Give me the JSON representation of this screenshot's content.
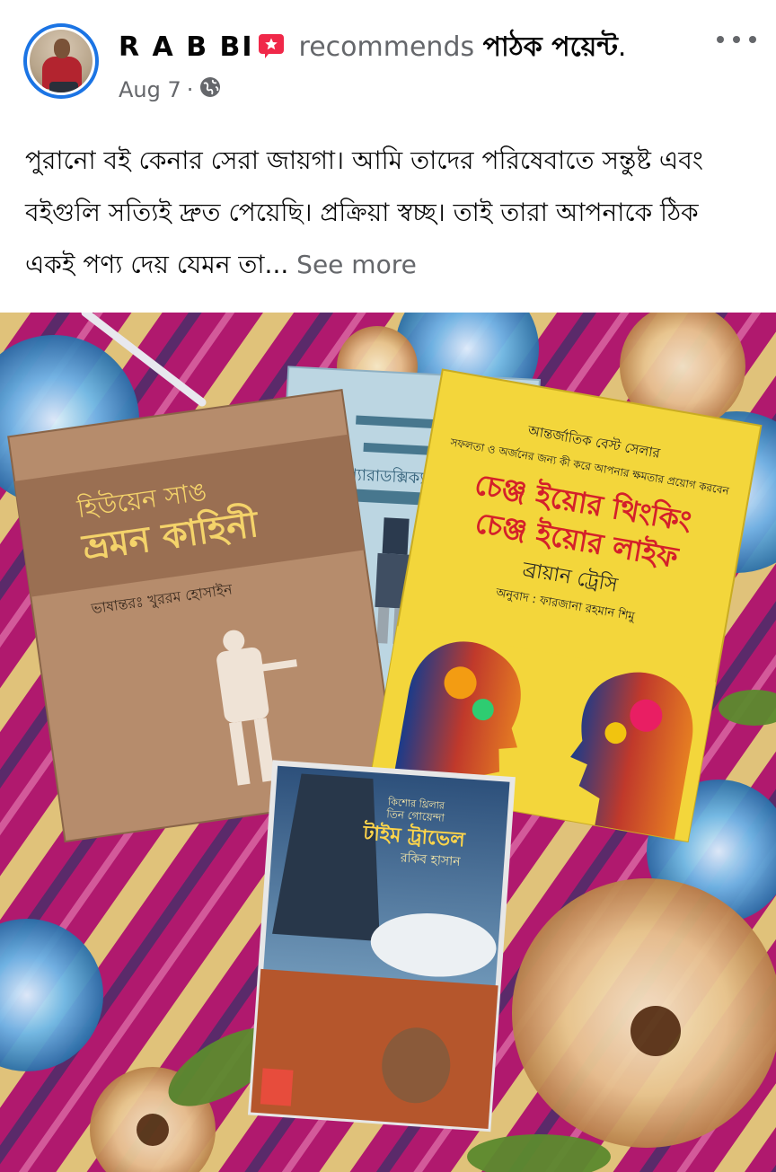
{
  "post": {
    "author": "R A B BI",
    "verb": "recommends",
    "page_name": "পাঠক পয়েন্ট",
    "date": "Aug 7",
    "separator": "·",
    "text": "পুরানো বই কেনার সেরা জায়গা। আমি তাদের পরিষেবাতে সন্তুষ্ট এবং বইগুলি সত্যিই দ্রুত পেয়েছি। প্রক্রিয়া স্বচ্ছ। তাই তারা আপনাকে ঠিক একই পণ্য দেয় যেমন তা...",
    "see_more": "See more"
  },
  "icons": {
    "more": "more-options-icon",
    "privacy": "globe-icon",
    "recommend": "recommend-badge-icon"
  },
  "colors": {
    "accent": "#1b74e4",
    "badge": "#f02849",
    "muted": "#65676b"
  },
  "photo": {
    "books": [
      {
        "title": "হিউয়েন সাঙ ভ্রমন কাহিনী",
        "title_line1": "হিউয়েন সাঙ",
        "title_line2": "ভ্রমন কাহিনী",
        "translator": "ভাষান্তরঃ খুররম হোসাইন"
      },
      {
        "title": "প্যারাডক্সিক্যাল সাজিদ"
      },
      {
        "kicker": "আন্তর্জাতিক বেস্ট সেলার",
        "subtitle": "সফলতা ও অর্জনের জন্য কী করে আপনার ক্ষমতার প্রয়োগ করবেন",
        "title_line1": "চেঞ্জ ইয়োর থিংকিং",
        "title_line2": "চেঞ্জ ইয়োর লাইফ",
        "author": "ব্রায়ান ট্রেসি",
        "translator": "অনুবাদ : ফারজানা রহমান শিমু"
      },
      {
        "series": "কিশোর থ্রিলার",
        "series2": "তিন গোয়েন্দা",
        "title": "টাইম ট্রাভেল",
        "author": "রকিব হাসান"
      }
    ]
  }
}
